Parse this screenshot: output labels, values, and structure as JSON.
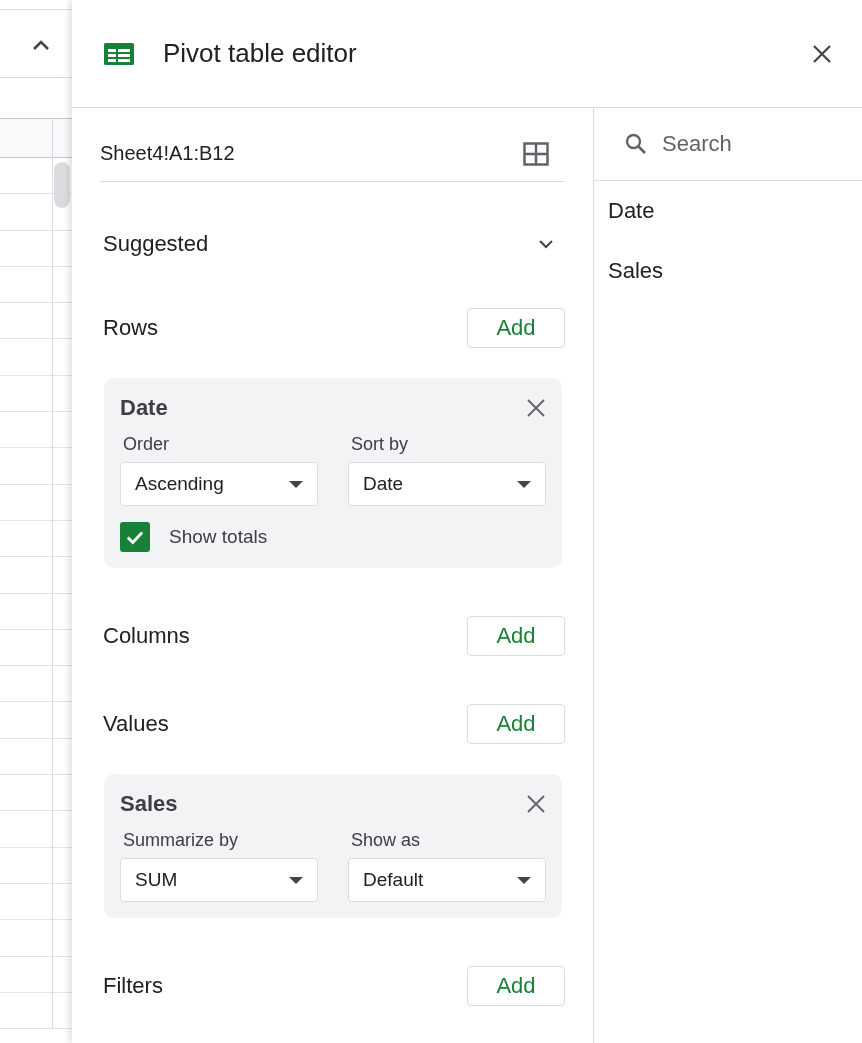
{
  "sheet": {
    "collapse_expanded": true
  },
  "header": {
    "title": "Pivot table editor"
  },
  "range": {
    "value": "Sheet4!A1:B12"
  },
  "sections": [
    {
      "kind": "collapsible",
      "title": "Suggested",
      "expanded": false
    },
    {
      "kind": "group",
      "title": "Rows",
      "add_label": "Add",
      "cards": [
        {
          "name": "Date",
          "fields": [
            {
              "label": "Order",
              "value": "Ascending"
            },
            {
              "label": "Sort by",
              "value": "Date"
            }
          ],
          "show_totals": {
            "label": "Show totals",
            "checked": true
          }
        }
      ]
    },
    {
      "kind": "group",
      "title": "Columns",
      "add_label": "Add"
    },
    {
      "kind": "group",
      "title": "Values",
      "add_label": "Add",
      "cards": [
        {
          "name": "Sales",
          "fields": [
            {
              "label": "Summarize by",
              "value": "SUM"
            },
            {
              "label": "Show as",
              "value": "Default"
            }
          ]
        }
      ]
    },
    {
      "kind": "group",
      "title": "Filters",
      "add_label": "Add"
    }
  ],
  "field_search": {
    "placeholder": "Search"
  },
  "fields": [
    "Date",
    "Sales"
  ]
}
